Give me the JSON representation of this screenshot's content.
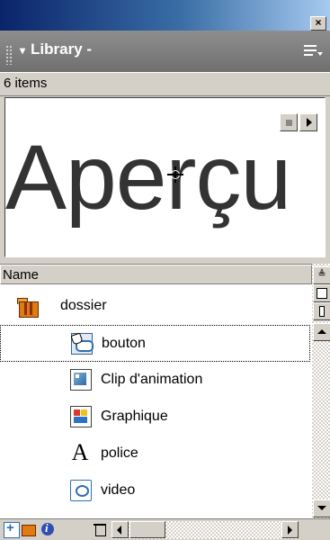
{
  "window": {
    "close_glyph": "×"
  },
  "panel": {
    "title": "Library -",
    "collapse_glyph": "▾"
  },
  "status": {
    "item_count": "6 items"
  },
  "preview": {
    "text": "Aperçu"
  },
  "list": {
    "column_header": "Name",
    "sort_glyph": "≜",
    "items": [
      {
        "name": "dossier",
        "icon": "folder-icon"
      },
      {
        "name": "bouton",
        "icon": "button-symbol-icon"
      },
      {
        "name": "Clip d'animation",
        "icon": "movie-clip-icon"
      },
      {
        "name": "Graphique",
        "icon": "graphic-symbol-icon"
      },
      {
        "name": "police",
        "icon": "font-icon"
      },
      {
        "name": "video",
        "icon": "video-icon"
      }
    ],
    "font_glyph": "A"
  },
  "colors": {
    "header_gray": "#7f7f7f",
    "folder_orange": "#e07a12",
    "panel_face": "#d4d0c8"
  }
}
